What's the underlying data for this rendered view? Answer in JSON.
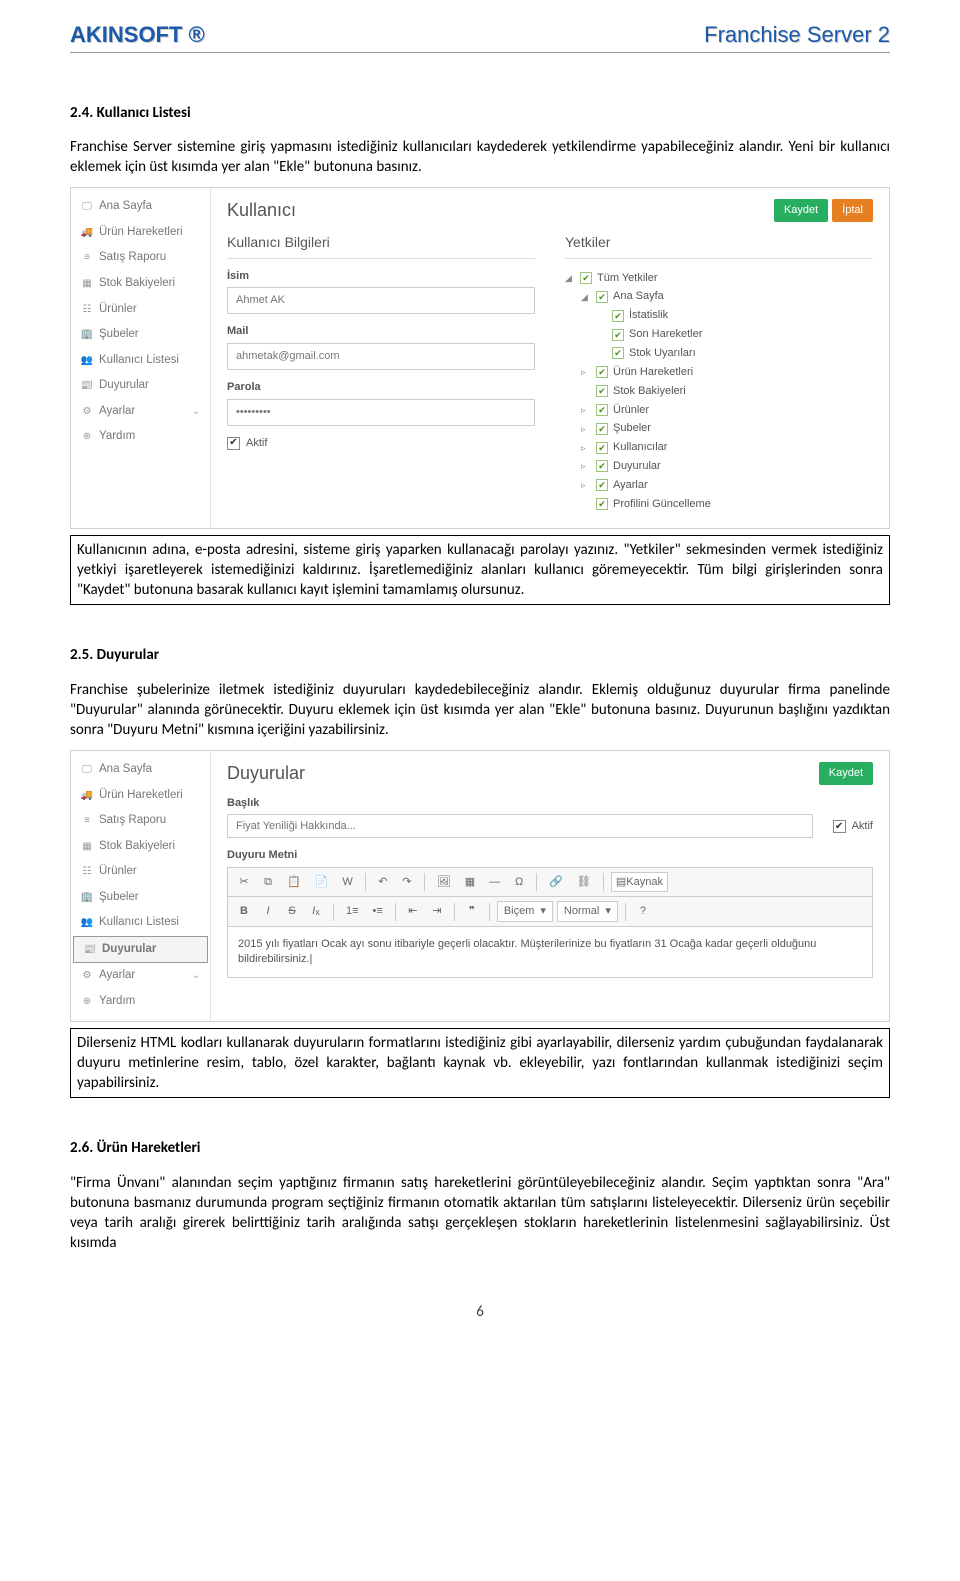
{
  "header": {
    "brand_left": "AKINSOFT ®",
    "brand_right": "Franchise Server 2"
  },
  "sections": {
    "s24_heading": "2.4. Kullanıcı Listesi",
    "s24_p": "Franchise Server sistemine giriş yapmasını istediğiniz kullanıcıları kaydederek yetkilendirme yapabileceğiniz alandır. Yeni bir kullanıcı eklemek için üst kısımda yer alan \"Ekle\" butonuna basınız.",
    "s24_caption": "Kullanıcının adına, e-posta adresini, sisteme giriş yaparken kullanacağı parolayı yazınız. \"Yetkiler\" sekmesinden vermek istediğiniz yetkiyi işaretleyerek istemediğinizi kaldırınız. İşaretlemediğiniz alanları kullanıcı göremeyecektir. Tüm bilgi girişlerinden sonra \"Kaydet\" butonuna basarak kullanıcı kayıt işlemini tamamlamış olursunuz.",
    "s25_heading": "2.5. Duyurular",
    "s25_p": "Franchise şubelerinize iletmek istediğiniz duyuruları kaydedebileceğiniz alandır.  Eklemiş olduğunuz duyurular firma panelinde \"Duyurular\" alanında görünecektir. Duyuru eklemek için üst kısımda yer alan \"Ekle\" butonuna basınız. Duyurunun başlığını yazdıktan sonra \"Duyuru Metni\" kısmına içeriğini yazabilirsiniz.",
    "s25_caption": "Dilerseniz HTML kodları kullanarak duyuruların formatlarını istediğiniz gibi ayarlayabilir, dilerseniz yardım çubuğundan faydalanarak duyuru metinlerine resim, tablo, özel karakter, bağlantı kaynak vb. ekleyebilir, yazı fontlarından kullanmak istediğinizi seçim yapabilirsiniz.",
    "s26_heading": "2.6. Ürün Hareketleri",
    "s26_p": "\"Firma Ünvanı\" alanından seçim yaptığınız firmanın satış hareketlerini görüntüleyebileceğiniz alandır. Seçim yaptıktan sonra \"Ara\" butonuna basmanız durumunda program seçtiğiniz firmanın otomatik aktarılan tüm satışlarını listeleyecektir. Dilerseniz ürün seçebilir veya tarih aralığı girerek belirttiğiniz tarih aralığında satışı gerçekleşen stokların hareketlerinin listelenmesini sağlayabilirsiniz. Üst kısımda"
  },
  "user_panel": {
    "title": "Kullanıcı",
    "btn_save": "Kaydet",
    "btn_cancel": "İptal",
    "sidebar": {
      "items": [
        "Ana Sayfa",
        "Ürün Hareketleri",
        "Satış Raporu",
        "Stok Bakiyeleri",
        "Ürünler",
        "Şubeler",
        "Kullanıcı Listesi",
        "Duyurular",
        "Ayarlar",
        "Yardım"
      ]
    },
    "form": {
      "col1_heading": "Kullanıcı Bilgileri",
      "name_label": "İsim",
      "name_value": "Ahmet AK",
      "mail_label": "Mail",
      "mail_value": "ahmetak@gmail.com",
      "pass_label": "Parola",
      "pass_value": "•••••••••",
      "active_label": "Aktif",
      "col2_heading": "Yetkiler",
      "perm_root": "Tüm Yetkiler",
      "perm_home": "Ana Sayfa",
      "perm_stats": "İstatislik",
      "perm_recent": "Son Hareketler",
      "perm_stockwarn": "Stok Uyarıları",
      "perm_urun": "Ürün Hareketleri",
      "perm_sbak": "Stok Bakiyeleri",
      "perm_urunler": "Ürünler",
      "perm_subeler": "Şubeler",
      "perm_kullanicilar": "Kullanıcılar",
      "perm_duyurular": "Duyurular",
      "perm_ayarlar": "Ayarlar",
      "perm_profil": "Profilini Güncelleme"
    }
  },
  "ann_panel": {
    "title": "Duyurular",
    "btn_save": "Kaydet",
    "sidebar": {
      "items": [
        "Ana Sayfa",
        "Ürün Hareketleri",
        "Satış Raporu",
        "Stok Bakiyeleri",
        "Ürünler",
        "Şubeler",
        "Kullanıcı Listesi",
        "Duyurular",
        "Ayarlar",
        "Yardım"
      ]
    },
    "title_label": "Başlık",
    "title_placeholder": "Fiyat Yeniliği Hakkında...",
    "active_label": "Aktif",
    "body_label": "Duyuru Metni",
    "toolbar": {
      "source": "Kaynak",
      "style": "Biçem",
      "normal": "Normal"
    },
    "content": "2015 yılı fiyatları Ocak ayı sonu itibariyle geçerli olacaktır. Müşterilerinize bu fiyatların 31 Ocağa kadar geçerli olduğunu bildirebilirsiniz.|"
  },
  "page_number": "6"
}
